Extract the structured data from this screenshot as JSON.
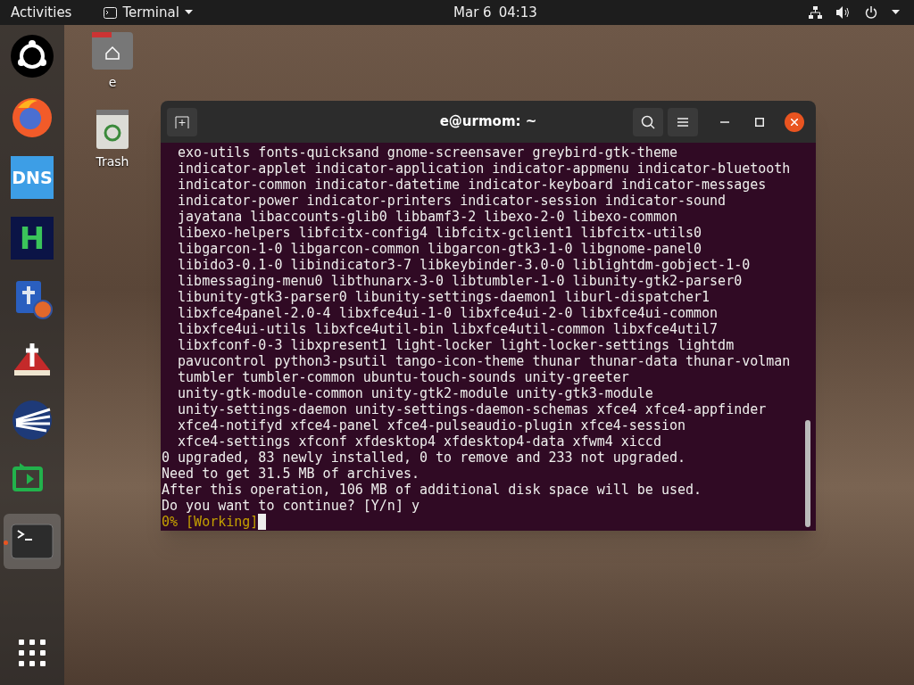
{
  "top_bar": {
    "activities": "Activities",
    "app_menu": "Terminal",
    "date": "Mar 6",
    "time": "04:13"
  },
  "dock": {
    "items": [
      {
        "kind": "ubuntu",
        "running": false
      },
      {
        "kind": "firefox",
        "running": false
      },
      {
        "kind": "tile",
        "label": "DNS",
        "color": "#3d9ee6",
        "running": false
      },
      {
        "kind": "tile",
        "label": "H",
        "color": "#0b1446",
        "running": false
      },
      {
        "kind": "book",
        "running": false
      },
      {
        "kind": "bible",
        "running": false
      },
      {
        "kind": "globe",
        "running": false
      },
      {
        "kind": "share",
        "running": false
      },
      {
        "kind": "terminal",
        "running": true
      }
    ]
  },
  "desktop_icons": [
    {
      "kind": "home",
      "label": "e"
    },
    {
      "kind": "trash",
      "label": "Trash"
    }
  ],
  "terminal": {
    "title": "e@urmom: ~",
    "lines": [
      {
        "kind": "output",
        "text": "  exo-utils fonts-quicksand gnome-screensaver greybird-gtk-theme"
      },
      {
        "kind": "output",
        "text": "  indicator-applet indicator-application indicator-appmenu indicator-bluetooth"
      },
      {
        "kind": "output",
        "text": "  indicator-common indicator-datetime indicator-keyboard indicator-messages"
      },
      {
        "kind": "output",
        "text": "  indicator-power indicator-printers indicator-session indicator-sound"
      },
      {
        "kind": "output",
        "text": "  jayatana libaccounts-glib0 libbamf3-2 libexo-2-0 libexo-common"
      },
      {
        "kind": "output",
        "text": "  libexo-helpers libfcitx-config4 libfcitx-gclient1 libfcitx-utils0"
      },
      {
        "kind": "output",
        "text": "  libgarcon-1-0 libgarcon-common libgarcon-gtk3-1-0 libgnome-panel0"
      },
      {
        "kind": "output",
        "text": "  libido3-0.1-0 libindicator3-7 libkeybinder-3.0-0 liblightdm-gobject-1-0"
      },
      {
        "kind": "output",
        "text": "  libmessaging-menu0 libthunarx-3-0 libtumbler-1-0 libunity-gtk2-parser0"
      },
      {
        "kind": "output",
        "text": "  libunity-gtk3-parser0 libunity-settings-daemon1 liburl-dispatcher1"
      },
      {
        "kind": "output",
        "text": "  libxfce4panel-2.0-4 libxfce4ui-1-0 libxfce4ui-2-0 libxfce4ui-common"
      },
      {
        "kind": "output",
        "text": "  libxfce4ui-utils libxfce4util-bin libxfce4util-common libxfce4util7"
      },
      {
        "kind": "output",
        "text": "  libxfconf-0-3 libxpresent1 light-locker light-locker-settings lightdm"
      },
      {
        "kind": "output",
        "text": "  pavucontrol python3-psutil tango-icon-theme thunar thunar-data thunar-volman"
      },
      {
        "kind": "output",
        "text": "  tumbler tumbler-common ubuntu-touch-sounds unity-greeter"
      },
      {
        "kind": "output",
        "text": "  unity-gtk-module-common unity-gtk2-module unity-gtk3-module"
      },
      {
        "kind": "output",
        "text": "  unity-settings-daemon unity-settings-daemon-schemas xfce4 xfce4-appfinder"
      },
      {
        "kind": "output",
        "text": "  xfce4-notifyd xfce4-panel xfce4-pulseaudio-plugin xfce4-session"
      },
      {
        "kind": "output",
        "text": "  xfce4-settings xfconf xfdesktop4 xfdesktop4-data xfwm4 xiccd"
      },
      {
        "kind": "output",
        "text": "0 upgraded, 83 newly installed, 0 to remove and 233 not upgraded."
      },
      {
        "kind": "output",
        "text": "Need to get 31.5 MB of archives."
      },
      {
        "kind": "output",
        "text": "After this operation, 106 MB of additional disk space will be used."
      },
      {
        "kind": "output",
        "text": "Do you want to continue? [Y/n] y"
      },
      {
        "kind": "progress",
        "text": "0% [Working]"
      }
    ]
  }
}
